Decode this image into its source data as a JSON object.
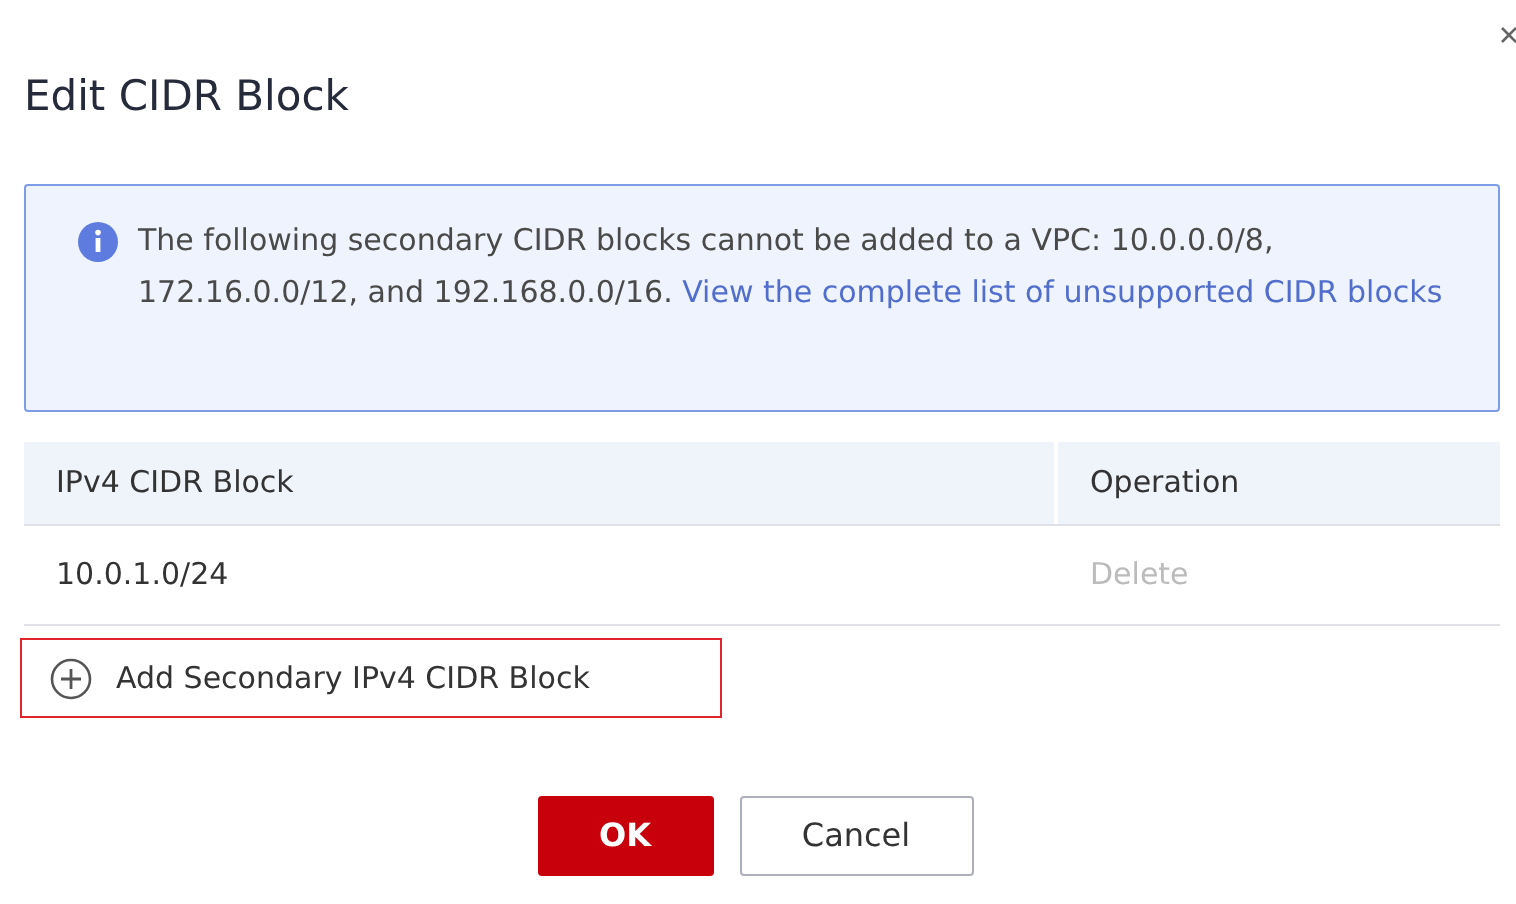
{
  "dialog": {
    "title": "Edit CIDR Block"
  },
  "notice": {
    "text": "The following secondary CIDR blocks cannot be added to a VPC: 10.0.0.0/8, 172.16.0.0/12, and 192.168.0.0/16.",
    "link": "View the complete list of unsupported CIDR blocks"
  },
  "table": {
    "columns": [
      "IPv4 CIDR Block",
      "Operation"
    ],
    "rows": [
      {
        "cidr": "10.0.1.0/24",
        "action": "Delete",
        "disabled": true
      }
    ]
  },
  "add_button": {
    "label": "Add Secondary IPv4 CIDR Block",
    "highlighted": true
  },
  "buttons": [
    {
      "label": "OK",
      "kind": "primary"
    },
    {
      "label": "Cancel",
      "kind": "secondary"
    }
  ]
}
